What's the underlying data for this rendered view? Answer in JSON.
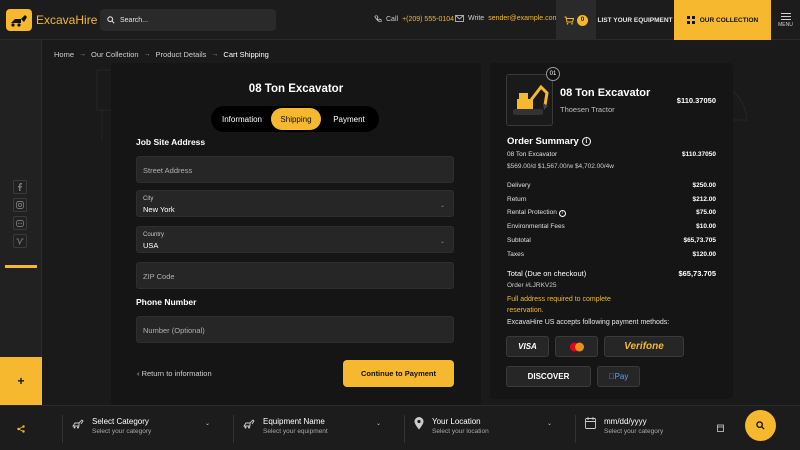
{
  "header": {
    "logo_text": "Excava",
    "logo_text_suffix": "Hire",
    "search_placeholder": "Search...",
    "phone_label": "Call",
    "phone": "+(209) 555-0104",
    "email_label": "Write",
    "email": "sender@example.com",
    "cart_count": "0",
    "list_equipment": "LIST YOUR EQUIPMENT",
    "our_collection": "OUR COLLECTION",
    "menu_label": "MENU"
  },
  "breadcrumb": [
    "Home",
    "Our Collection",
    "Product Details",
    "Cart Shipping"
  ],
  "form": {
    "title": "08 Ton Excavator",
    "tabs": [
      "Information",
      "Shipping",
      "Payment"
    ],
    "active_tab": "Shipping",
    "job_site_label": "Job Site Address",
    "street_placeholder": "Street Address",
    "city_label": "City",
    "city_value": "New York",
    "country_label": "Country",
    "country_value": "USA",
    "zip_placeholder": "ZIP Code",
    "phone_label": "Phone Number",
    "phone_placeholder": "Number (Optional)",
    "return_link": "Return to information",
    "continue_button": "Continue to Payment"
  },
  "summary": {
    "item_number": "01",
    "product_name": "08 Ton Excavator",
    "product_brand": "Thoesen Tractor",
    "product_price": "$110.37050",
    "order_summary_title": "Order Summary",
    "line_item_name": "08 Ton Excavator",
    "line_item_price": "$110.37050",
    "line_item_rates": "$569.00/d $1,567.00/w $4,702.00/4w",
    "rows": [
      {
        "label": "Delivery",
        "value": "$250.00"
      },
      {
        "label": "Return",
        "value": "$212.00"
      },
      {
        "label": "Rental Protection",
        "value": "$75.00"
      },
      {
        "label": "Environmental Fees",
        "value": "$10.00"
      },
      {
        "label": "Subtotal",
        "value": "$65,73.705"
      },
      {
        "label": "Taxes",
        "value": "$120.00"
      }
    ],
    "total_label": "Total (Due on checkout)",
    "total_value": "$65,73.705",
    "order_id": "Order #LJRKV25",
    "warning": "Full address required to complete reservation.",
    "accepts_text": "ExcavaHire US accepts following payment methods:",
    "payment_methods": [
      "VISA",
      "Mastercard",
      "Verifone",
      "DISCOVER",
      "Pay"
    ]
  },
  "bottom_bar": {
    "fields": [
      {
        "title": "Select Category",
        "sub": "Select your category"
      },
      {
        "title": "Equipment Name",
        "sub": "Select your equipment"
      },
      {
        "title": "Your Location",
        "sub": "Select your location"
      },
      {
        "title": "mm/dd/yyyy",
        "sub": "Select your category"
      }
    ]
  },
  "colors": {
    "accent": "#f5b82e",
    "background": "#1a1a1a",
    "panel": "#151515",
    "field": "#262626"
  }
}
